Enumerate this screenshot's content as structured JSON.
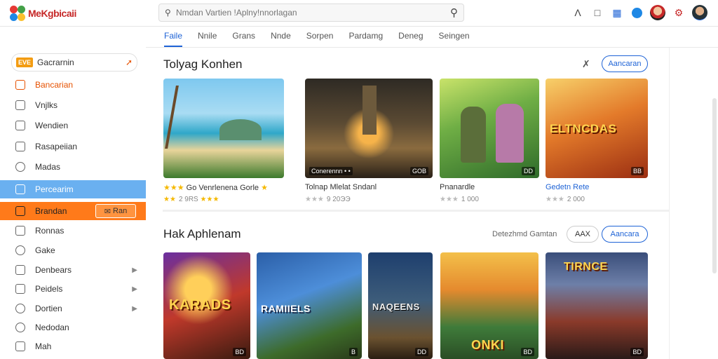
{
  "app": {
    "logo_text": "MeKgbicaii"
  },
  "search": {
    "placeholder": "Nmdan Vartien !Aplny!nnorlagan",
    "value": ""
  },
  "topbar": {
    "icons": [
      "caret-up-icon",
      "bookmark-icon",
      "badge-icon",
      "notification-icon",
      "user-avatar",
      "settings-icon",
      "profile-avatar"
    ]
  },
  "tabs": [
    "Faile",
    "Nnile",
    "Grans",
    "Nnde",
    "Sorpen",
    "Pardamg",
    "Deneg",
    "Seingen"
  ],
  "sidebar": {
    "header": {
      "badge": "EVE",
      "label": "Gacrarnin"
    },
    "items": [
      {
        "label": "Bancarian",
        "icon": "tag-icon"
      },
      {
        "label": "Vnjlks",
        "icon": "list-icon"
      },
      {
        "label": "Wendien",
        "icon": "photo-icon"
      },
      {
        "label": "Rasapeiian",
        "icon": "box-icon"
      },
      {
        "label": "Madas",
        "icon": "clock-icon"
      },
      {
        "label": "Percearim",
        "icon": "folder-icon"
      },
      {
        "label": "Brandan",
        "icon": "folder-icon",
        "pill": "Ran"
      },
      {
        "label": "Ronnas",
        "icon": "mail-icon"
      },
      {
        "label": "Gake",
        "icon": "settings-icon"
      },
      {
        "label": "Denbears",
        "icon": "grid-icon"
      },
      {
        "label": "Peidels",
        "icon": "file-icon"
      },
      {
        "label": "Dortien",
        "icon": "circle-icon"
      },
      {
        "label": "Nedodan",
        "icon": "clock-icon"
      },
      {
        "label": "Mah",
        "icon": "home-icon"
      }
    ]
  },
  "section1": {
    "title": "Tolyag Konhen",
    "action_icon": "close-x-icon",
    "button": "Aancaran",
    "cards": [
      {
        "title": "Go Venrlenena Gorle",
        "rating_text": "2 9RS",
        "corner": "",
        "overlay": "",
        "stars_gold": true
      },
      {
        "title": "Tolnap Mlelat Sndanl",
        "rating_text": "9 20ЭЭ",
        "corner": "GOB",
        "overlay": "",
        "banner": "Conerennn • •",
        "stars_gold": false
      },
      {
        "title": "Pnanardle",
        "rating_text": "1 000",
        "corner": "DD",
        "overlay": "",
        "stars_gold": false
      },
      {
        "title": "Gedetn Rete",
        "rating_text": "2 000",
        "corner": "BB",
        "overlay": "ELTNCDAS",
        "stars_gold": false
      }
    ]
  },
  "section2": {
    "title": "Hak Aphlenam",
    "label": "Detezhmd Gamtan",
    "box": "AAX",
    "button": "Aancara",
    "cards": [
      {
        "overlay": "KARADS",
        "corner": "BD"
      },
      {
        "overlay": "RAMIIELS",
        "corner": "B"
      },
      {
        "overlay": "NAQEENS",
        "corner": "DD"
      },
      {
        "overlay": "ONKI",
        "corner": "BD"
      },
      {
        "overlay": "TIRNCE",
        "corner": "BD"
      }
    ]
  }
}
